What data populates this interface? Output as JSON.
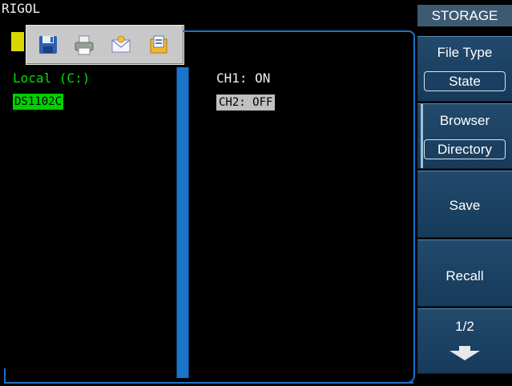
{
  "brand": "RIGOL",
  "toolbar": {
    "buttons": [
      {
        "icon": "save-floppy-icon"
      },
      {
        "icon": "printer-icon"
      },
      {
        "icon": "email-icon"
      },
      {
        "icon": "folder-files-icon"
      }
    ]
  },
  "left_pane": {
    "drive": "Local (C:)",
    "folder": "DS1102C"
  },
  "right_pane": {
    "items": [
      "CH1: ON",
      "CH2: OFF"
    ]
  },
  "menu": {
    "title": "STORAGE",
    "file_type_label": "File Type",
    "file_type_value": "State",
    "browser_label": "Browser",
    "browser_value": "Directory",
    "save_label": "Save",
    "recall_label": "Recall",
    "page": "1/2"
  },
  "colors": {
    "frame": "#1b74c7",
    "drive_text": "#00e000",
    "menu_bg": "#1f4566",
    "menu_title_bg": "#3c5a72"
  }
}
